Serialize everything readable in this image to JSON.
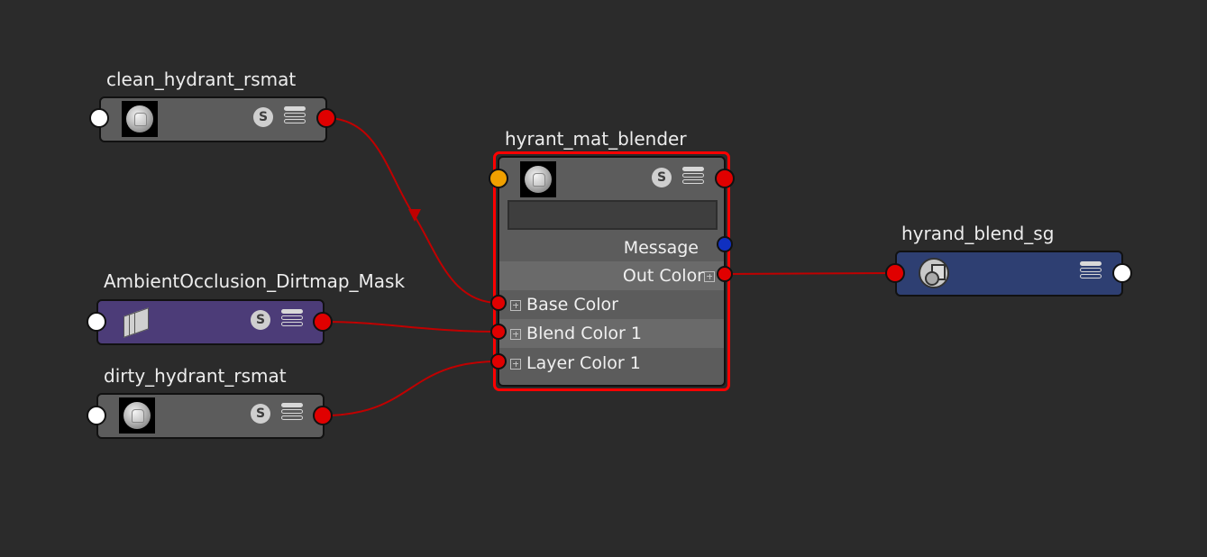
{
  "nodes": {
    "clean": {
      "title": "clean_hydrant_rsmat",
      "s_label": "S"
    },
    "ao": {
      "title": "AmbientOcclusion_Dirtmap_Mask",
      "s_label": "S"
    },
    "dirty": {
      "title": "dirty_hydrant_rsmat",
      "s_label": "S"
    },
    "blender": {
      "title": "hyrant_mat_blender",
      "s_label": "S",
      "search_value": "",
      "attrs": {
        "message": "Message",
        "out_color": "Out Color",
        "base_color": "Base Color",
        "blend_color": "Blend Color 1",
        "layer_color": "Layer Color 1"
      }
    },
    "sg": {
      "title": "hyrand_blend_sg"
    }
  },
  "colors": {
    "background": "#2b2b2b",
    "wire": "#c00000",
    "selection": "#ff0000",
    "port_red": "#e00000",
    "port_orange": "#f0a000",
    "port_blue": "#1030c0",
    "node_gray": "#5c5c5c",
    "node_purple": "#4c3c78",
    "node_blue": "#2e3f72"
  },
  "icons": {
    "material_thumbnail": "material-sphere-icon",
    "texture": "file-layers-icon",
    "shading_group": "shading-group-icon",
    "swatch_toggle": "s-icon",
    "attribute_view": "menu-icon"
  }
}
